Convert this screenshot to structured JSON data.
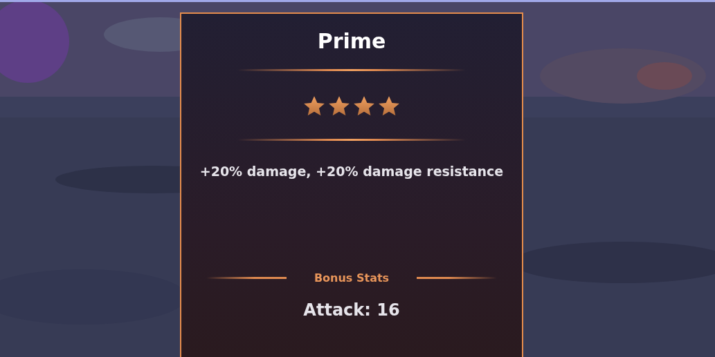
{
  "card": {
    "title": "Prime",
    "stars": 4,
    "description": "+20% damage, +20% damage resistance",
    "bonus_heading": "Bonus Stats",
    "bonus_stat": "Attack: 16"
  }
}
